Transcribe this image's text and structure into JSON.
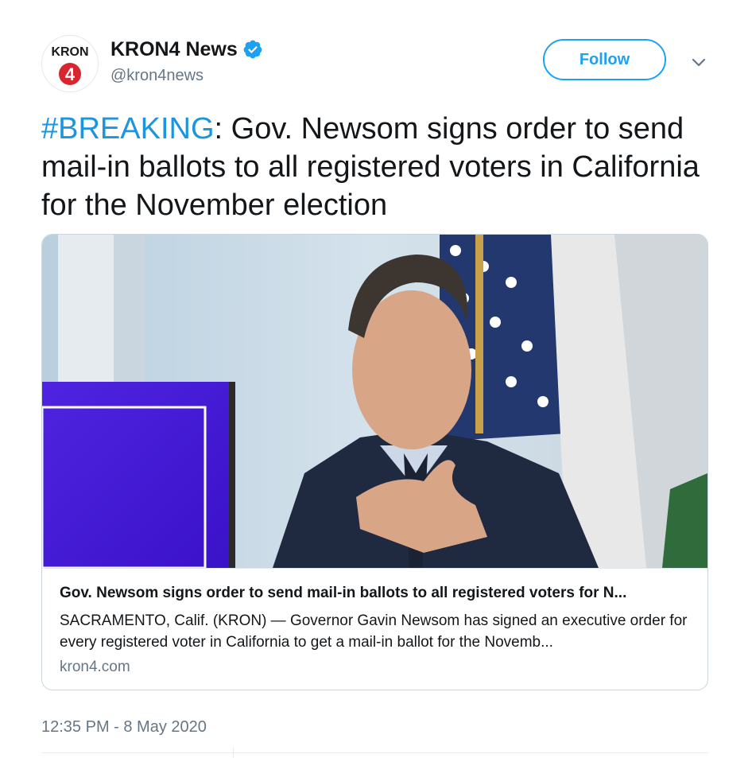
{
  "account": {
    "display_name": "KRON4 News",
    "handle": "@kron4news",
    "verified": true,
    "avatar_logo_text": "KRON",
    "avatar_logo_number": "4",
    "avatar_icon": "kron4-logo-icon"
  },
  "actions": {
    "follow_label": "Follow",
    "more_icon": "chevron-down-icon"
  },
  "tweet": {
    "hashtag": "#BREAKING",
    "text": ": Gov. Newsom signs order to send mail-in ballots to all registered voters in California for the November election",
    "timestamp": "12:35 PM - 8 May 2020"
  },
  "card": {
    "image_icon": "news-photo-image",
    "title": "Gov. Newsom signs order to send mail-in ballots to all registered voters for N...",
    "description": "SACRAMENTO, Calif. (KRON) — Governor Gavin Newsom has signed an executive order for every registered voter in California to get a mail-in ballot for the Novemb...",
    "domain": "kron4.com"
  },
  "colors": {
    "accent": "#1da1f2",
    "hashtag": "#1b95e0",
    "text": "#14171a",
    "secondary": "#657786",
    "kron_red": "#d7262f"
  }
}
